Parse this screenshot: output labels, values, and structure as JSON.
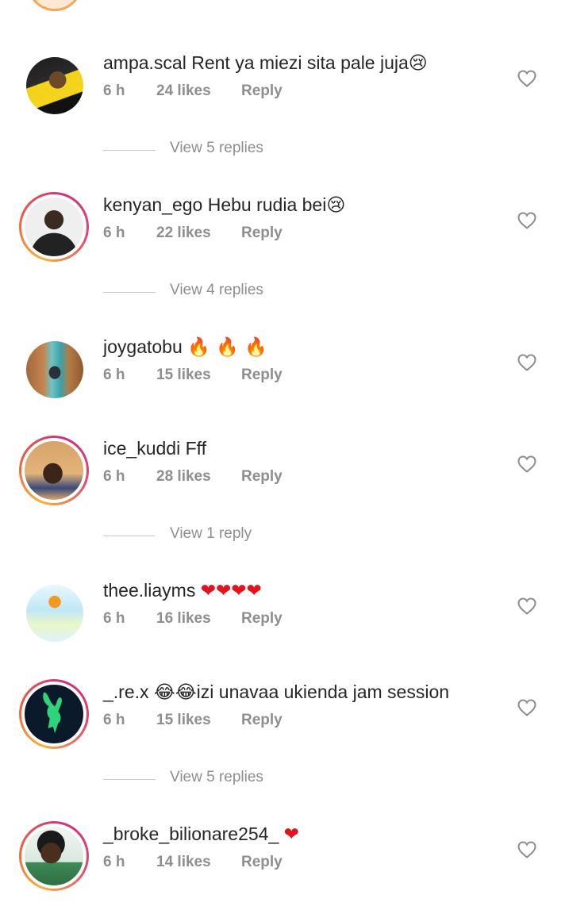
{
  "comments": [
    {
      "username": "ampa.scal",
      "text": "Rent ya miezi sita pale juja",
      "emoji": "😢",
      "time": "6 h",
      "likes": "24 likes",
      "reply": "Reply",
      "view_replies": "View 5 replies"
    },
    {
      "username": "kenyan_ego",
      "text": "Hebu rudia bei",
      "emoji": "😢",
      "time": "6 h",
      "likes": "22 likes",
      "reply": "Reply",
      "view_replies": "View 4 replies"
    },
    {
      "username": "joygatobu",
      "text": "",
      "emoji": "🔥 🔥 🔥",
      "time": "6 h",
      "likes": "15 likes",
      "reply": "Reply"
    },
    {
      "username": "ice_kuddi",
      "text": "Fff",
      "emoji": "",
      "time": "6 h",
      "likes": "28 likes",
      "reply": "Reply",
      "view_replies": "View 1 reply"
    },
    {
      "username": "thee.liayms",
      "text": "",
      "emoji": "❤❤❤❤",
      "time": "6 h",
      "likes": "16 likes",
      "reply": "Reply"
    },
    {
      "username": "_.re.x",
      "emoji_prefix": "😂😂",
      "text": "izi unavaa ukienda jam session",
      "time": "6 h",
      "likes": "15 likes",
      "reply": "Reply",
      "view_replies": "View 5 replies"
    },
    {
      "username": "_broke_bilionare254_",
      "text": "",
      "emoji": "❤",
      "time": "6 h",
      "likes": "14 likes",
      "reply": "Reply"
    }
  ],
  "colors": {
    "meta": "#8e8e8e",
    "text": "#262626",
    "heart_outline": "#8e8e8e"
  },
  "icons": {
    "like": "heart-outline-icon"
  }
}
